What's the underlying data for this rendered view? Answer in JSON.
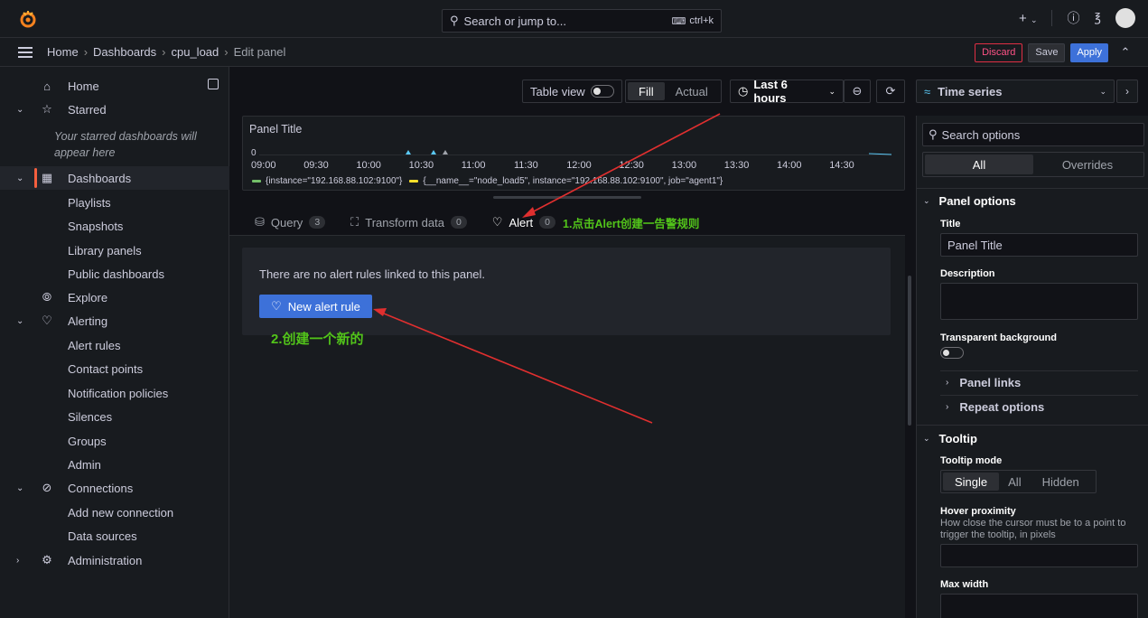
{
  "topbar": {
    "search_placeholder": "Search or jump to...",
    "search_shortcut": "ctrl+k",
    "plus_label": "+"
  },
  "breadcrumbs": [
    "Home",
    "Dashboards",
    "cpu_load",
    "Edit panel"
  ],
  "actions": {
    "discard": "Discard",
    "save": "Save",
    "apply": "Apply"
  },
  "sidebar": {
    "home": "Home",
    "starred": "Starred",
    "starred_note": "Your starred dashboards will appear here",
    "dashboards": "Dashboards",
    "playlists": "Playlists",
    "snapshots": "Snapshots",
    "library_panels": "Library panels",
    "public_dashboards": "Public dashboards",
    "explore": "Explore",
    "alerting": "Alerting",
    "alert_rules": "Alert rules",
    "contact_points": "Contact points",
    "notification_policies": "Notification policies",
    "silences": "Silences",
    "groups": "Groups",
    "admin": "Admin",
    "connections": "Connections",
    "add_new_connection": "Add new connection",
    "data_sources": "Data sources",
    "administration": "Administration"
  },
  "toolbar": {
    "table_view": "Table view",
    "fill": "Fill",
    "actual": "Actual",
    "time_range": "Last 6 hours"
  },
  "panel": {
    "title": "Panel Title",
    "y_zero": "0",
    "x_ticks": [
      "09:00",
      "09:30",
      "10:00",
      "10:30",
      "11:00",
      "11:30",
      "12:00",
      "12:30",
      "13:00",
      "13:30",
      "14:00",
      "14:30"
    ],
    "legend_1": "{instance=\"192.168.88.102:9100\"}",
    "legend_2": "{__name__=\"node_load5\", instance=\"192.168.88.102:9100\", job=\"agent1\"}",
    "colors": {
      "series_1": "#73bf69",
      "series_2": "#fade2a",
      "accent": "#5ac8f5"
    }
  },
  "tabs": {
    "query": "Query",
    "query_count": "3",
    "transform": "Transform data",
    "transform_count": "0",
    "alert": "Alert",
    "alert_count": "0"
  },
  "annotations": {
    "step1": "1.点击Alert创建一告警规则",
    "step2": "2.创建一个新的",
    "arrow_color": "#e02f2f",
    "text_color": "#52c41a"
  },
  "alert_tab": {
    "no_rules": "There are no alert rules linked to this panel.",
    "new_rule": "New alert rule"
  },
  "options": {
    "viz": "Time series",
    "search_placeholder": "Search options",
    "all": "All",
    "overrides": "Overrides",
    "panel_options": "Panel options",
    "title_label": "Title",
    "title_value": "Panel Title",
    "description_label": "Description",
    "transparent_label": "Transparent background",
    "panel_links": "Panel links",
    "repeat_options": "Repeat options",
    "tooltip": "Tooltip",
    "tooltip_mode": "Tooltip mode",
    "mode_single": "Single",
    "mode_all": "All",
    "mode_hidden": "Hidden",
    "hover_proximity": "Hover proximity",
    "hover_desc": "How close the cursor must be to a point to trigger the tooltip, in pixels",
    "max_width": "Max width"
  }
}
